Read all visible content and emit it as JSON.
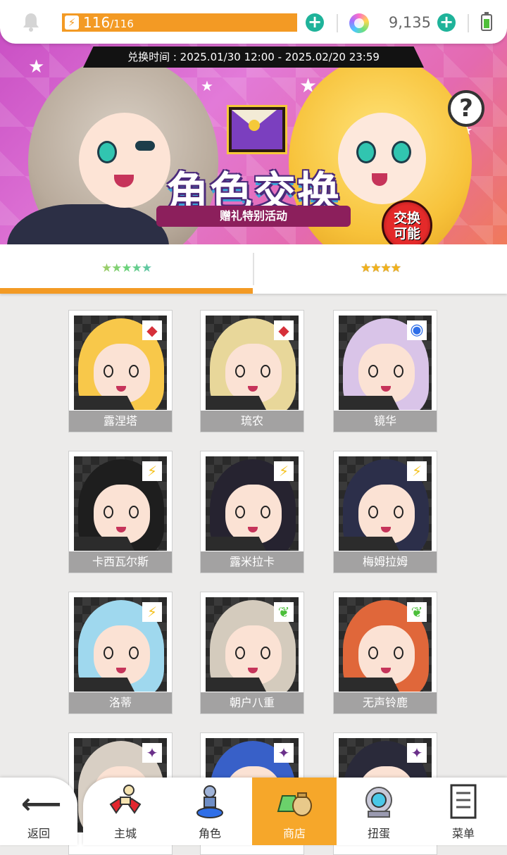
{
  "status": {
    "stamina_current": "116",
    "stamina_max": "/116",
    "gems": "9,135"
  },
  "banner": {
    "period": "兑换时间 : 2025.01/30 12:00 - 2025.02/20 23:59",
    "title": "角色交换",
    "subtitle": "赠礼特别活动",
    "badge_line1": "交换",
    "badge_line2": "可能",
    "help": "?"
  },
  "tabs": [
    {
      "stars": "★★★★★",
      "rarity": 5,
      "active": true
    },
    {
      "stars": "★★★★",
      "rarity": 4,
      "active": false
    }
  ],
  "characters": [
    {
      "name": "露涅塔",
      "stars": "★★★★★",
      "element": "red-diamond",
      "hair": "#f8c84a"
    },
    {
      "name": "琉农",
      "stars": "★★★★★",
      "element": "red-diamond",
      "hair": "#e8d79a"
    },
    {
      "name": "镜华",
      "stars": "★★★★★",
      "element": "blue-circle",
      "hair": "#d9c4e8"
    },
    {
      "name": "卡西瓦尔斯",
      "stars": "★★★★★",
      "element": "lightning",
      "hair": "#1e1e1e"
    },
    {
      "name": "露米拉卡",
      "stars": "★★★★★",
      "element": "lightning",
      "hair": "#262330"
    },
    {
      "name": "梅姆拉姆",
      "stars": "★★★★★",
      "element": "lightning",
      "hair": "#2c2f4a"
    },
    {
      "name": "洛蒂",
      "stars": "★★★★★",
      "element": "lightning",
      "hair": "#9fd8ee"
    },
    {
      "name": "朝户八重",
      "stars": "★★★★★",
      "element": "leaf",
      "hair": "#d4cbbd"
    },
    {
      "name": "无声铃鹿",
      "stars": "★★★★★",
      "element": "leaf",
      "hair": "#e0673a"
    },
    {
      "name": "",
      "stars": "",
      "element": "dark-star",
      "hair": "#d8cfc4"
    },
    {
      "name": "",
      "stars": "",
      "element": "dark-star",
      "hair": "#3860c8"
    },
    {
      "name": "",
      "stars": "",
      "element": "dark-star",
      "hair": "#2a2a3a"
    }
  ],
  "nav": {
    "back": "返回",
    "items": [
      {
        "label": "主城",
        "icon": "castle-icon",
        "active": false
      },
      {
        "label": "角色",
        "icon": "character-icon",
        "active": false
      },
      {
        "label": "商店",
        "icon": "shop-icon",
        "active": true
      },
      {
        "label": "扭蛋",
        "icon": "gacha-icon",
        "active": false
      },
      {
        "label": "菜单",
        "icon": "menu-icon",
        "active": false
      }
    ]
  },
  "colors": {
    "accent": "#f39a24",
    "plus_button": "#1fb39a",
    "card_name_bg": "#a3a2a2"
  }
}
